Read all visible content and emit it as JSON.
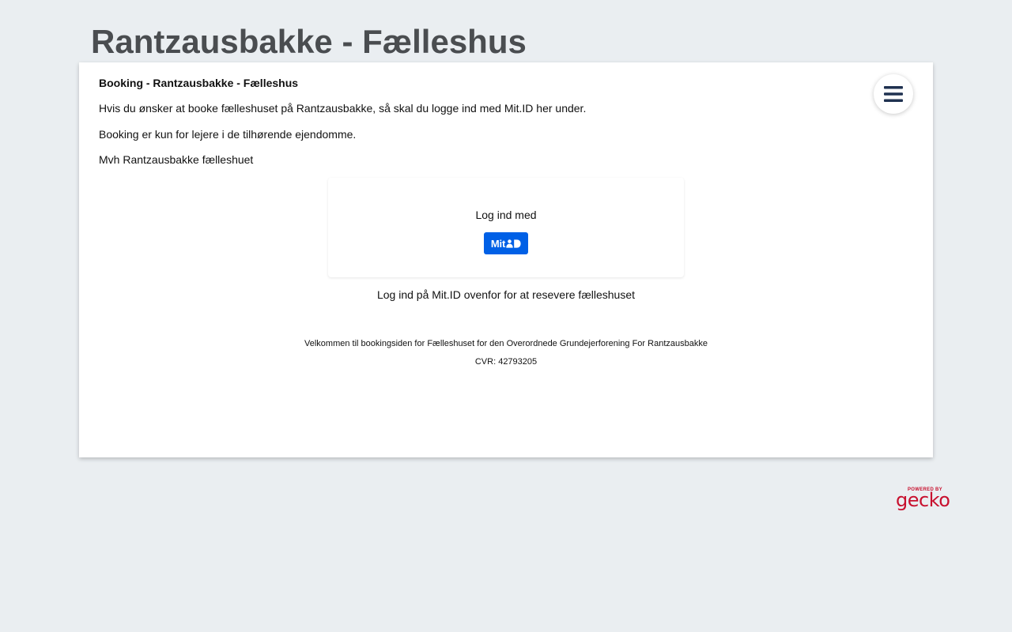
{
  "header": {
    "title": "Rantzausbakke - Fælleshus"
  },
  "intro": {
    "heading": "Booking - Rantzausbakke - Fælleshus",
    "paragraphs": [
      "Hvis du ønsker at booke fælleshuset på Rantzausbakke, så skal du logge ind med Mit.ID her under.",
      "Booking er kun for lejere i de tilhørende ejendomme.",
      "Mvh Rantzausbakke fælleshuet"
    ]
  },
  "menu": {
    "icon": "hamburger-menu-icon"
  },
  "login": {
    "label": "Log ind med",
    "mitid_button_text": "Mit",
    "mitid_icon": "mitid-logo-icon",
    "note": "Log ind på Mit.ID ovenfor for at resevere fælleshuset"
  },
  "footer": {
    "welcome": "Velkommen til bookingsiden for Fælleshuset for den Overordnede Grundejerforening For Rantzausbakke",
    "cvr": "CVR: 42793205"
  },
  "powered_by": {
    "label": "POWERED BY",
    "brand": "gecko"
  },
  "colors": {
    "background": "#eaeef1",
    "title": "#4a4d50",
    "mitid_blue": "#0060e6",
    "gecko_red": "#c8102e",
    "menu_icon": "#1f3150"
  }
}
